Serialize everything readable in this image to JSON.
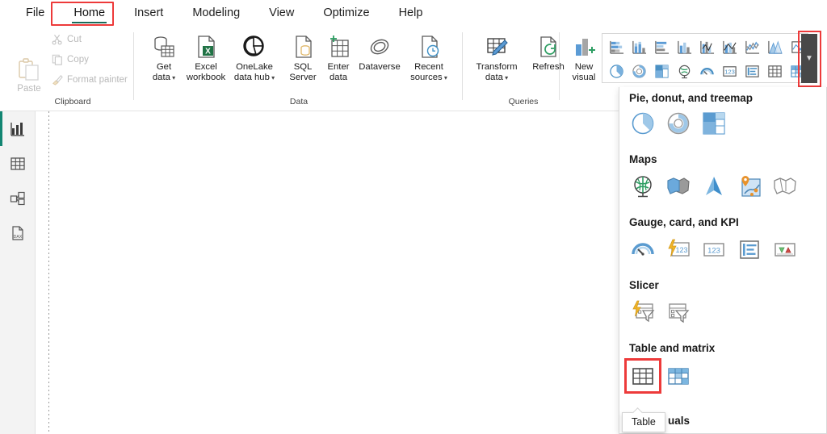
{
  "ribbon": {
    "tabs": [
      {
        "label": "File",
        "active": false
      },
      {
        "label": "Home",
        "active": true,
        "highlighted": true
      },
      {
        "label": "Insert",
        "active": false
      },
      {
        "label": "Modeling",
        "active": false
      },
      {
        "label": "View",
        "active": false
      },
      {
        "label": "Optimize",
        "active": false
      },
      {
        "label": "Help",
        "active": false
      }
    ],
    "groups": {
      "clipboard": {
        "label": "Clipboard",
        "paste_label": "Paste",
        "items": [
          {
            "label": "Cut",
            "icon": "scissors-icon",
            "disabled": true
          },
          {
            "label": "Copy",
            "icon": "copy-icon",
            "disabled": true
          },
          {
            "label": "Format painter",
            "icon": "format-painter-icon",
            "disabled": true
          }
        ]
      },
      "data": {
        "label": "Data",
        "items": [
          {
            "line1": "Get",
            "line2": "data",
            "chevron": true,
            "icon": "get-data-icon"
          },
          {
            "line1": "Excel",
            "line2": "workbook",
            "chevron": false,
            "icon": "excel-workbook-icon"
          },
          {
            "line1": "OneLake",
            "line2": "data hub",
            "chevron": true,
            "icon": "onelake-data-hub-icon"
          },
          {
            "line1": "SQL",
            "line2": "Server",
            "chevron": false,
            "icon": "sql-server-icon"
          },
          {
            "line1": "Enter",
            "line2": "data",
            "chevron": false,
            "icon": "enter-data-icon"
          },
          {
            "line1": "Dataverse",
            "line2": "",
            "chevron": false,
            "icon": "dataverse-icon"
          },
          {
            "line1": "Recent",
            "line2": "sources",
            "chevron": true,
            "icon": "recent-sources-icon"
          }
        ]
      },
      "queries": {
        "label": "Queries",
        "items": [
          {
            "line1": "Transform",
            "line2": "data",
            "chevron": true,
            "icon": "transform-data-icon"
          },
          {
            "line1": "Refresh",
            "line2": "",
            "chevron": false,
            "icon": "refresh-icon"
          }
        ]
      },
      "insert": {
        "new_visual": {
          "line1": "New",
          "line2": "visual",
          "icon": "new-visual-icon"
        }
      }
    },
    "gallery": {
      "row1": [
        "stacked-bar-chart-icon",
        "stacked-column-chart-icon",
        "clustered-bar-chart-icon",
        "clustered-column-chart-icon",
        "100-stacked-bar-chart-icon",
        "100-stacked-column-chart-icon",
        "line-chart-icon",
        "area-chart-icon",
        "stacked-area-chart-icon"
      ],
      "row2": [
        "pie-chart-icon",
        "donut-chart-icon",
        "treemap-icon",
        "map-icon",
        "gauge-icon",
        "card-icon",
        "multi-row-card-icon",
        "table-icon",
        "matrix-icon"
      ],
      "scroll_chevron": "chevron-down-icon"
    }
  },
  "nav_rail": {
    "items": [
      {
        "name": "report-view",
        "icon": "report-bar-chart-icon",
        "active": true
      },
      {
        "name": "table-view",
        "icon": "table-grid-icon",
        "active": false
      },
      {
        "name": "model-view",
        "icon": "model-relationship-icon",
        "active": false
      },
      {
        "name": "dax-query-view",
        "icon": "dax-query-icon",
        "active": false,
        "badge": "DAX"
      }
    ]
  },
  "flyout": {
    "sections": [
      {
        "title": "Pie, donut, and treemap",
        "icons": [
          "pie-chart-icon",
          "donut-chart-icon",
          "treemap-icon"
        ]
      },
      {
        "title": "Maps",
        "icons": [
          "map-globe-icon",
          "filled-map-icon",
          "azure-map-icon",
          "shape-map-pin-icon",
          "shape-map-icon"
        ]
      },
      {
        "title": "Gauge, card, and KPI",
        "icons": [
          "gauge-icon",
          "card-new-icon",
          "card-123-icon",
          "multi-row-card-icon",
          "kpi-icon"
        ]
      },
      {
        "title": "Slicer",
        "icons": [
          "slicer-new-icon",
          "slicer-icon"
        ]
      },
      {
        "title": "Table and matrix",
        "icons": [
          "table-icon",
          "matrix-icon"
        ],
        "selected_index": 0
      }
    ],
    "partial_next_section": "uals"
  },
  "tooltip": {
    "text": "Table"
  },
  "colors": {
    "highlight_red": "#ed3a3a",
    "tab_underline_teal": "#1b6b58",
    "rail_active_teal": "#128572",
    "power_bi_blue": "#4a90c4",
    "excel_green": "#217346",
    "accent_orange": "#e8a33d",
    "scrollbar_dark": "#484848"
  }
}
